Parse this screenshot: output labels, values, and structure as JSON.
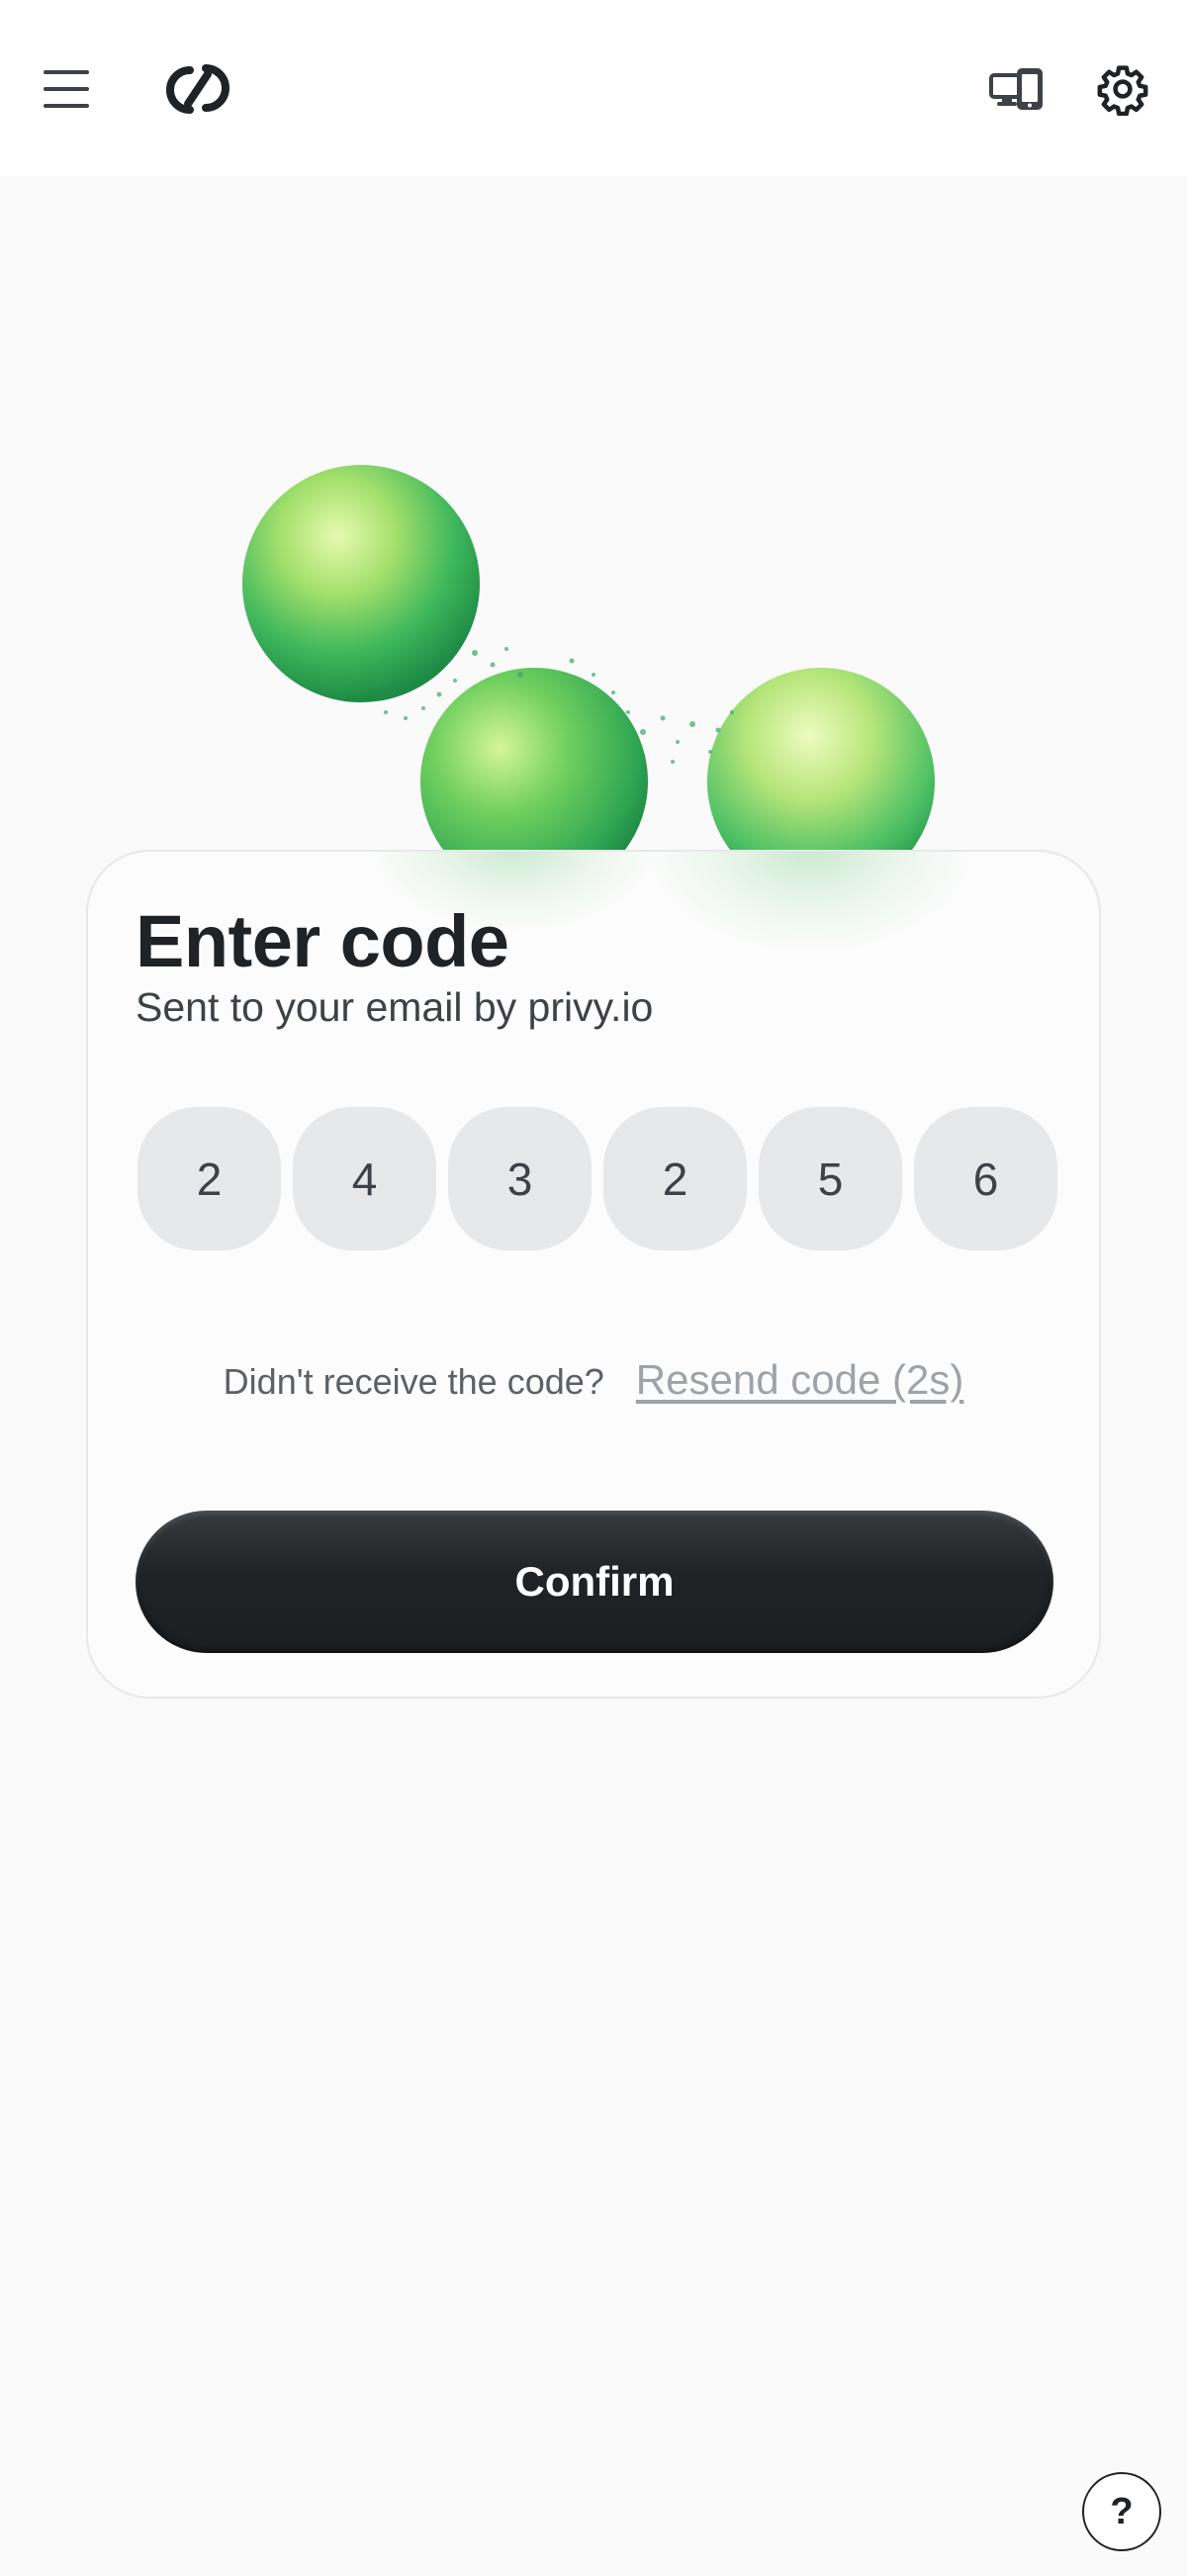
{
  "header": {
    "menu_icon": "hamburger-menu-icon",
    "logo_icon": "linked-rings-logo-icon",
    "device_icon": "desktop-and-phone-icon",
    "settings_icon": "gear-icon"
  },
  "hero": {
    "image": "green-bubbly-spheres-illustration",
    "colors": [
      "#8fd86a",
      "#3fb85c",
      "#d9f7a0"
    ]
  },
  "card": {
    "title": "Enter code",
    "subtitle": "Sent to your email by privy.io",
    "otp_digits": [
      "2",
      "4",
      "3",
      "2",
      "5",
      "6"
    ],
    "resend_prompt": "Didn't receive the code?",
    "resend_link": "Resend code (2s)",
    "confirm_label": "Confirm"
  },
  "help": {
    "label": "?",
    "icon": "help-question-icon"
  },
  "colors": {
    "background": "#fafafa",
    "card_border": "#e6e8ea",
    "otp_box": "#e6e8e9",
    "button": "#1f2326",
    "muted_link": "#9ea3a7"
  }
}
